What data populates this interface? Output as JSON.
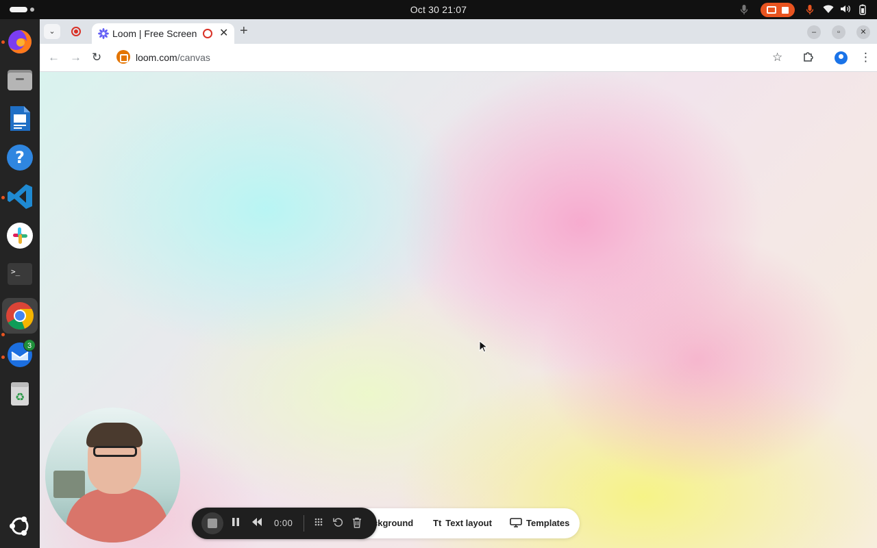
{
  "system": {
    "datetime": "Oct 30  21:07",
    "icons": [
      "mic-icon",
      "screen-record-icon",
      "stop-record-icon",
      "mic-active-icon",
      "wifi-icon",
      "volume-icon",
      "battery-icon"
    ]
  },
  "dock": {
    "apps": [
      {
        "name": "Firefox",
        "icon": "firefox-icon"
      },
      {
        "name": "Files",
        "icon": "files-icon"
      },
      {
        "name": "LibreOffice Writer",
        "icon": "writer-icon"
      },
      {
        "name": "Help",
        "icon": "help-icon"
      },
      {
        "name": "Visual Studio Code",
        "icon": "vscode-icon"
      },
      {
        "name": "Slack",
        "icon": "slack-icon"
      },
      {
        "name": "Terminal",
        "icon": "terminal-icon"
      },
      {
        "name": "Google Chrome",
        "icon": "chrome-icon"
      },
      {
        "name": "Thunderbird",
        "icon": "thunderbird-icon",
        "badge": "3"
      },
      {
        "name": "Trash",
        "icon": "trash-icon"
      }
    ],
    "show_apps_icon": "ubuntu-logo-icon"
  },
  "browser": {
    "tab": {
      "title": "Loom | Free Screen &"
    },
    "address": {
      "host": "loom.com",
      "path": "/canvas"
    }
  },
  "recorder": {
    "timer": "0:00",
    "options": [
      {
        "label": "ckground",
        "icon": "background-icon"
      },
      {
        "label": "Text layout",
        "icon_text": "Tt"
      },
      {
        "label": "Templates",
        "icon": "monitor-icon"
      }
    ]
  },
  "colors": {
    "accent": "#e95420",
    "chrome_tab_bg": "#dfe3e8",
    "recorder_bar": "#1f1f1f"
  }
}
